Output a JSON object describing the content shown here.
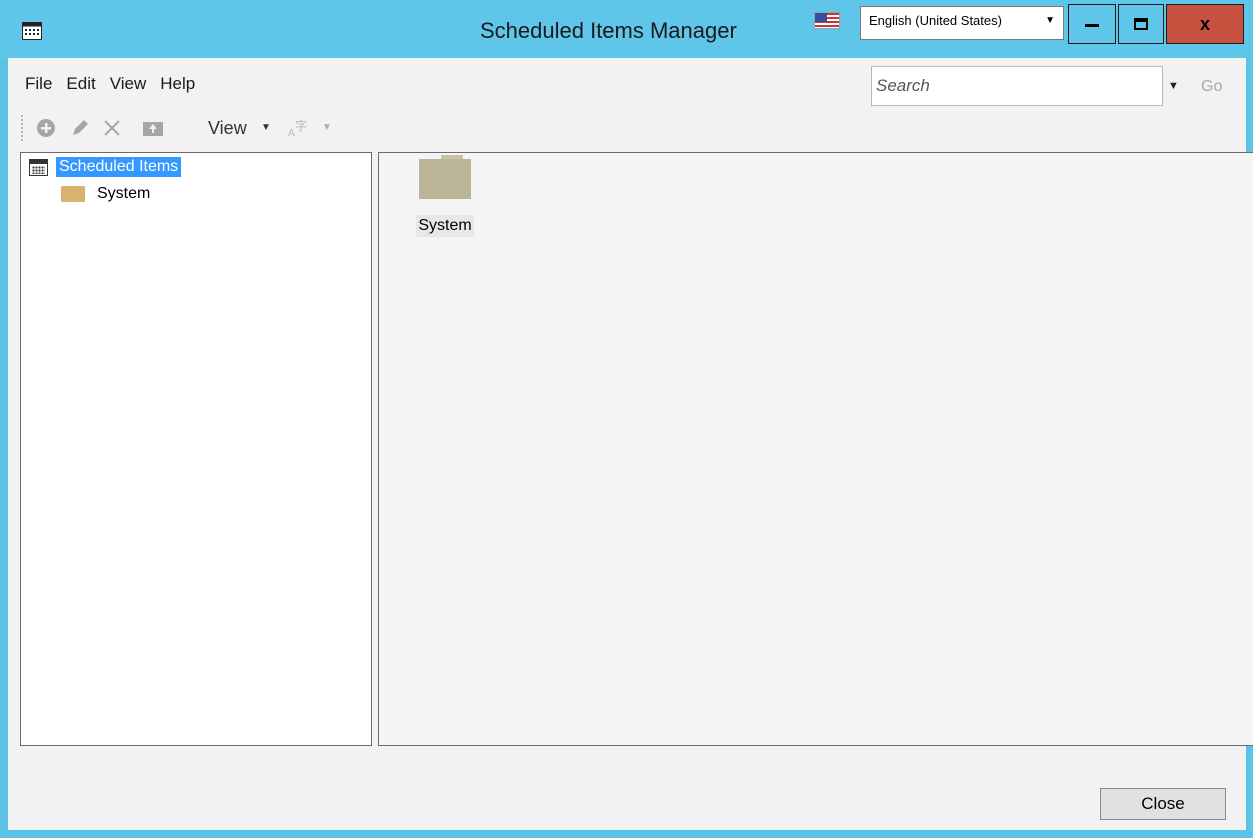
{
  "window": {
    "title": "Scheduled Items Manager",
    "language": "English (United States)",
    "minimize_label": "—",
    "maximize_label": "▭",
    "close_label": "x"
  },
  "menu": {
    "items": [
      "File",
      "Edit",
      "View",
      "Help"
    ]
  },
  "search": {
    "placeholder": "Search",
    "go_label": "Go"
  },
  "toolbar": {
    "icons": [
      "add-icon",
      "edit-icon",
      "delete-icon",
      "up-folder-icon",
      "font-icon"
    ],
    "view_label": "View"
  },
  "tree": {
    "root_label": "Scheduled Items",
    "children": [
      "System"
    ]
  },
  "content": {
    "items": [
      {
        "label": "System",
        "icon": "folder-icon"
      }
    ]
  },
  "footer": {
    "close_label": "Close"
  },
  "colors": {
    "title_bar": "#5fc6ea",
    "close_button": "#c7513f",
    "selection": "#3399ff",
    "folder": "#d9b36e"
  }
}
